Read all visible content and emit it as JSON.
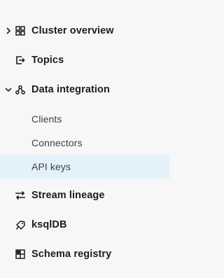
{
  "nav": {
    "items": [
      {
        "label": "Cluster overview",
        "icon": "grid-icon",
        "expanded": false
      },
      {
        "label": "Topics",
        "icon": "topic-icon"
      },
      {
        "label": "Data integration",
        "icon": "integration-icon",
        "expanded": true,
        "children": [
          {
            "label": "Clients"
          },
          {
            "label": "Connectors"
          },
          {
            "label": "API keys",
            "active": true
          }
        ]
      },
      {
        "label": "Stream lineage",
        "icon": "stream-lineage-icon"
      },
      {
        "label": "ksqlDB",
        "icon": "ksqldb-icon"
      },
      {
        "label": "Schema registry",
        "icon": "schema-registry-icon"
      }
    ]
  },
  "colors": {
    "background": "#f7f7f8",
    "active_background": "#e3f1f9",
    "text": "#1a1d21"
  }
}
